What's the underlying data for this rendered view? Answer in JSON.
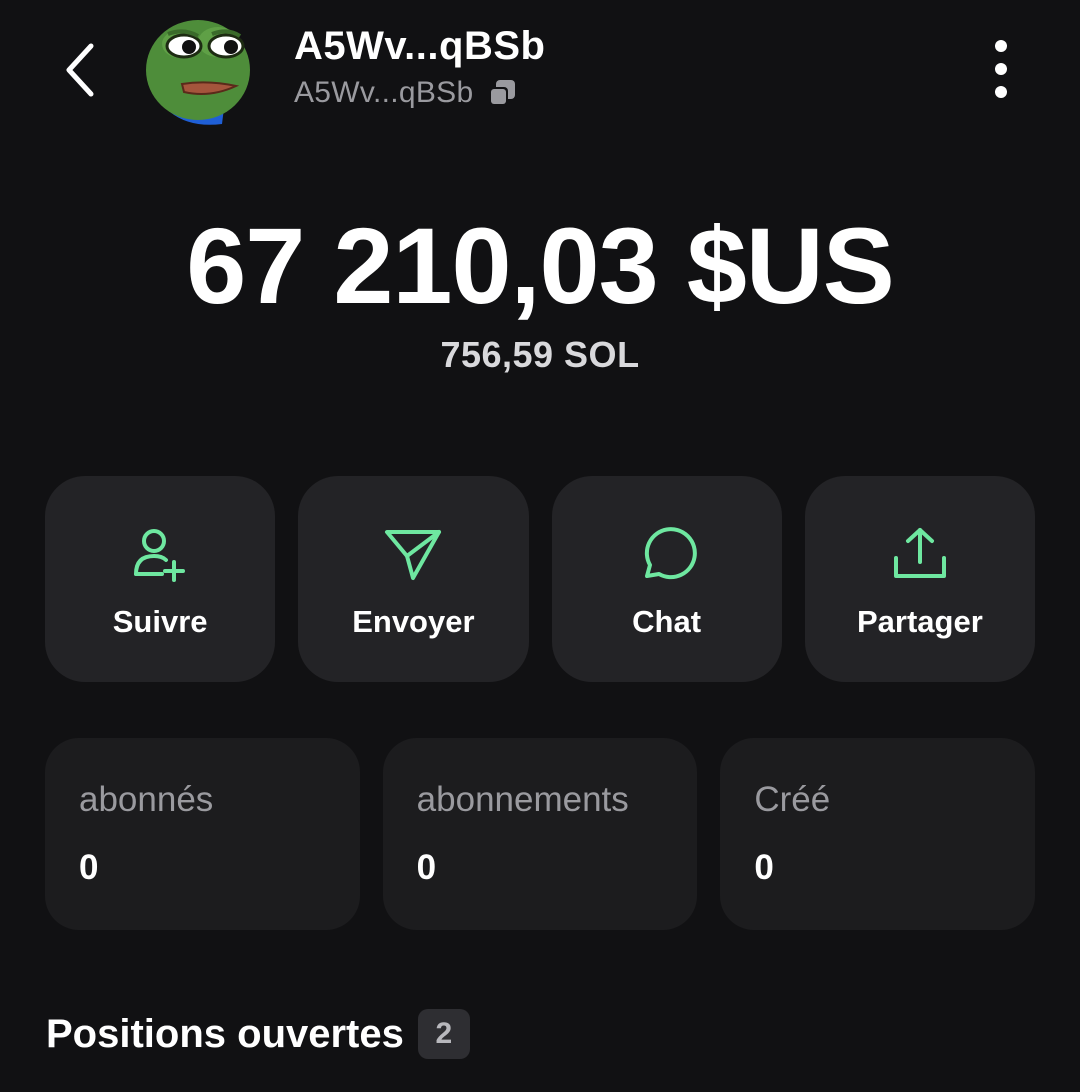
{
  "header": {
    "name": "A5Wv...qBSb",
    "address": "A5Wv...qBSb"
  },
  "balance": {
    "usd": "67 210,03 $US",
    "sol": "756,59 SOL"
  },
  "actions": [
    {
      "label": "Suivre",
      "icon": "user-plus-icon"
    },
    {
      "label": "Envoyer",
      "icon": "send-icon"
    },
    {
      "label": "Chat",
      "icon": "chat-bubble-icon"
    },
    {
      "label": "Partager",
      "icon": "share-upload-icon"
    }
  ],
  "stats": [
    {
      "label": "abonnés",
      "value": "0"
    },
    {
      "label": "abonnements",
      "value": "0"
    },
    {
      "label": "Créé",
      "value": "0"
    }
  ],
  "positions": {
    "title": "Positions ouvertes",
    "count": "2"
  },
  "colors": {
    "background": "#111113",
    "card": "#232326",
    "stat_card": "#1c1c1e",
    "accent": "#6ee7a0",
    "muted_text": "#9a9a9f"
  }
}
